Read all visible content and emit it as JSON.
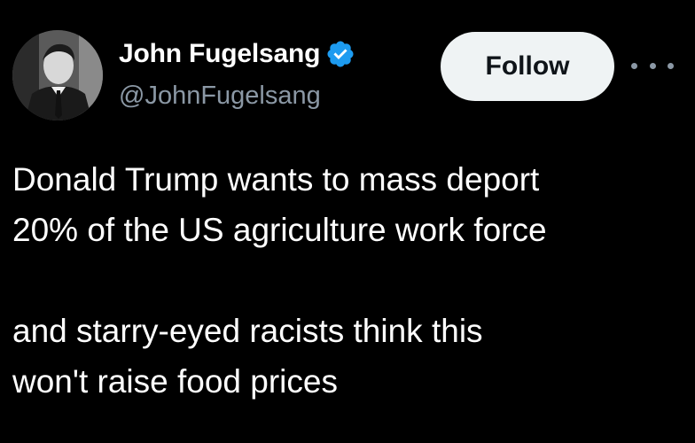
{
  "author": {
    "display_name": "John Fugelsang",
    "handle": "@JohnFugelsang",
    "verified": true,
    "verified_icon": "verified-badge-icon",
    "verified_color": "#1d9bf0"
  },
  "actions": {
    "follow_label": "Follow",
    "more_icon": "more-horizontal-icon"
  },
  "tweet": {
    "lines": [
      "Donald Trump wants to mass deport",
      "20% of the US agriculture work force",
      "",
      "and starry-eyed racists think this",
      "won't raise food prices"
    ]
  },
  "theme": {
    "background": "#000000",
    "text": "#ffffff",
    "secondary_text": "#8b98a5",
    "button_bg": "#eff3f4",
    "button_text": "#0f1419"
  }
}
